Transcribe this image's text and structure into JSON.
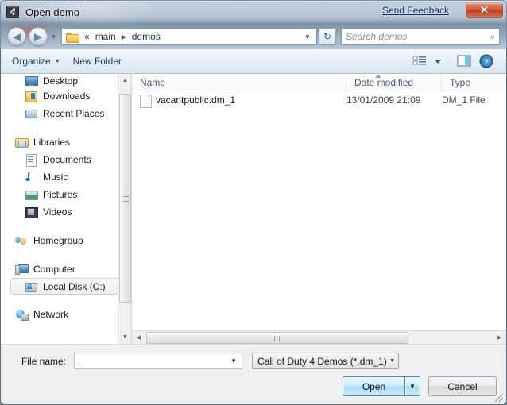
{
  "window": {
    "title": "Open demo",
    "app_icon": "4",
    "feedback_link": "Send Feedback",
    "close_label": "✕"
  },
  "nav": {
    "back_icon": "◀",
    "forward_icon": "▶",
    "history_caret": "▼",
    "breadcrumb": {
      "prefix": "«",
      "separator": "▸",
      "items": [
        "main",
        "demos"
      ]
    },
    "address_caret": "▼",
    "refresh_icon": "↻"
  },
  "search": {
    "placeholder": "Search demos",
    "value": "",
    "icon": "⌕"
  },
  "toolbar": {
    "organize_label": "Organize",
    "organize_caret": "▼",
    "new_folder_label": "New Folder",
    "views_caret": "▼",
    "view_icon": "list-view-icon",
    "preview_icon": "preview-pane-icon",
    "help_icon": "?"
  },
  "sidebar": {
    "scroll_up": "▲",
    "scroll_down": "▼",
    "items": [
      {
        "label": "Desktop",
        "icon": "desktop-icon",
        "level": 1,
        "selected": false
      },
      {
        "label": "Downloads",
        "icon": "downloads-icon",
        "level": 1,
        "selected": false
      },
      {
        "label": "Recent Places",
        "icon": "recent-places-icon",
        "level": 1,
        "selected": false
      },
      {
        "label": "Libraries",
        "icon": "libraries-icon",
        "level": 0,
        "selected": false,
        "gap_before": true
      },
      {
        "label": "Documents",
        "icon": "documents-icon",
        "level": 1,
        "selected": false
      },
      {
        "label": "Music",
        "icon": "music-icon",
        "level": 1,
        "selected": false
      },
      {
        "label": "Pictures",
        "icon": "pictures-icon",
        "level": 1,
        "selected": false
      },
      {
        "label": "Videos",
        "icon": "videos-icon",
        "level": 1,
        "selected": false
      },
      {
        "label": "Homegroup",
        "icon": "homegroup-icon",
        "level": 0,
        "selected": false,
        "gap_before": true
      },
      {
        "label": "Computer",
        "icon": "computer-icon",
        "level": 0,
        "selected": false,
        "gap_before": true
      },
      {
        "label": "Local Disk (C:)",
        "icon": "local-disk-icon",
        "level": 1,
        "selected": true
      },
      {
        "label": "Network",
        "icon": "network-icon",
        "level": 0,
        "selected": false,
        "gap_before": true
      }
    ]
  },
  "file_list": {
    "columns": [
      "Name",
      "Date modified",
      "Type"
    ],
    "sort_column": "Name",
    "sort_direction": "ascending",
    "rows": [
      {
        "name": "vacantpublic.dm_1",
        "date_modified": "13/01/2009 21:09",
        "type": "DM_1 File",
        "icon": "file-icon"
      }
    ],
    "hscroll_left": "◀",
    "hscroll_right": "▶"
  },
  "footer": {
    "file_name_label": "File name:",
    "file_name_value": "",
    "file_name_caret": "▼",
    "filter_value": "Call of Duty 4 Demos (*.dm_1)",
    "filter_caret": "▼",
    "open_label": "Open",
    "open_caret": "▼",
    "cancel_label": "Cancel"
  }
}
